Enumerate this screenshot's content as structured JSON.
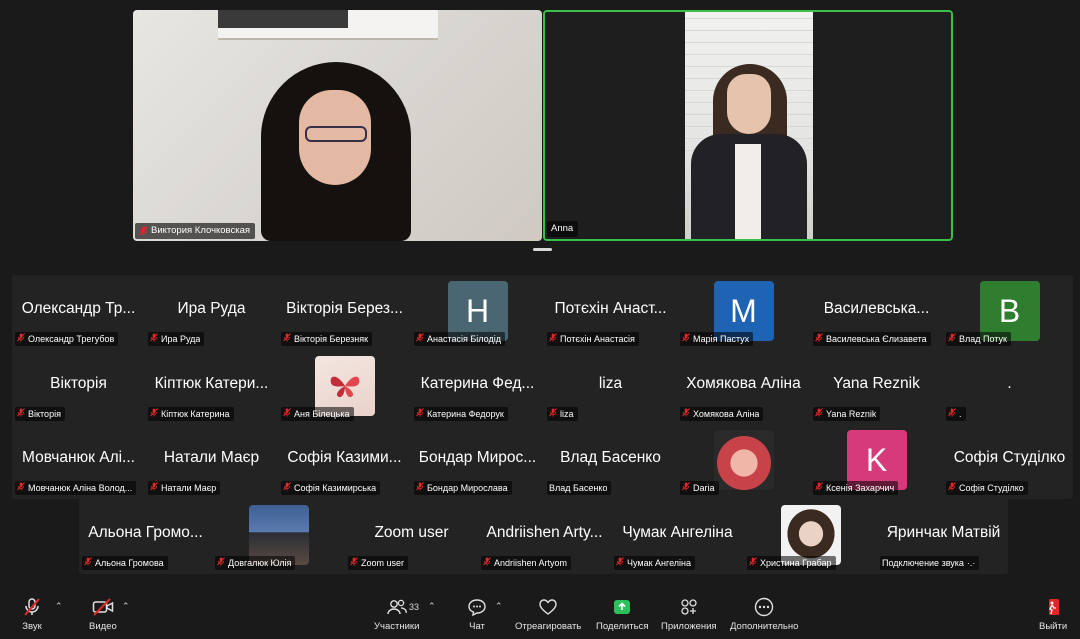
{
  "speakers": [
    {
      "name": "Виктория Клочковская",
      "muted": true
    },
    {
      "name": "Anna",
      "muted": false,
      "active": true
    }
  ],
  "gallery": [
    {
      "display": "Олександр Тр...",
      "label": "Олександр Трегубов",
      "muted": true
    },
    {
      "display": "Ира Руда",
      "label": "Ира Руда",
      "muted": true
    },
    {
      "display": "Вікторія Берез...",
      "label": "Вікторія Березняк",
      "muted": true
    },
    {
      "avatar": "H",
      "color": "#4a6673",
      "label": "Анастасія Білодід",
      "muted": true
    },
    {
      "display": "Потєхін Анаст...",
      "label": "Потєхін Анастасія",
      "muted": true
    },
    {
      "avatar": "M",
      "color": "#1e63b4",
      "label": "Марія Пастух",
      "muted": true
    },
    {
      "display": "Василевська...",
      "label": "Василевська Єлизавета",
      "muted": true
    },
    {
      "avatar": "B",
      "color": "#2f7d2f",
      "label": "Влад Потук",
      "muted": true
    },
    {
      "display": "Вікторія",
      "label": "Вікторія",
      "muted": true
    },
    {
      "display": "Кіптюк Катери...",
      "label": "Кіптюк Катерина",
      "muted": true
    },
    {
      "photo": "butterfly",
      "label": "Аня Білецька",
      "muted": true
    },
    {
      "display": "Катерина Фед...",
      "label": "Катерина Федорук",
      "muted": true
    },
    {
      "display": "liza",
      "label": "liza",
      "muted": true
    },
    {
      "display": "Хомякова Аліна",
      "label": "Хомякова Аліна",
      "muted": true
    },
    {
      "display": "Yana Reznik",
      "label": "Yana Reznik",
      "muted": true
    },
    {
      "display": ".",
      "label": ".",
      "muted": true
    },
    {
      "display": "Мовчанюк Алі...",
      "label": "Мовчанюк Аліна Волод...",
      "muted": true
    },
    {
      "display": "Натали Маєр",
      "label": "Натали Маєр",
      "muted": true
    },
    {
      "display": "Софія Казими...",
      "label": "Софія Казимирська",
      "muted": true
    },
    {
      "display": "Бондар Мирос...",
      "label": "Бондар Мирослава",
      "muted": true
    },
    {
      "display": "Влад Басенко",
      "label": "Влад Басенко",
      "muted": false
    },
    {
      "photo": "child",
      "label": "Daria",
      "muted": true
    },
    {
      "avatar": "K",
      "color": "#d63a7a",
      "label": "Ксенія Захарчич",
      "muted": true
    },
    {
      "display": "Софія Студілко",
      "label": "Софія Студілко",
      "muted": true
    },
    {
      "display": "Альона Громо...",
      "label": "Альона Громова",
      "muted": true
    },
    {
      "photo": "mountain",
      "label": "Довгалюк Юлія",
      "muted": true
    },
    {
      "display": "Zoom user",
      "label": "Zoom user",
      "muted": true
    },
    {
      "display": "Andriishen Arty...",
      "label": "Andriishen Artyom",
      "muted": true
    },
    {
      "display": "Чумак Ангеліна",
      "label": "Чумак Ангеліна",
      "muted": true
    },
    {
      "photo": "portrait",
      "label": "Христина Грабар",
      "muted": true
    },
    {
      "display": "Яринчак Матвій",
      "label": "Подключение звука",
      "muted": false,
      "connecting": true
    }
  ],
  "toolbar": {
    "audio_label": "Звук",
    "video_label": "Видео",
    "participants_label": "Участники",
    "participants_count": "33",
    "chat_label": "Чат",
    "react_label": "Отреагировать",
    "share_label": "Поделиться",
    "apps_label": "Приложения",
    "more_label": "Дополнительно",
    "leave_label": "Выйти"
  },
  "colors": {
    "active_speaker": "#3bbf4b",
    "muted_mic": "#e02828",
    "share_green": "#2dbf5a",
    "leave_red": "#e02828"
  }
}
